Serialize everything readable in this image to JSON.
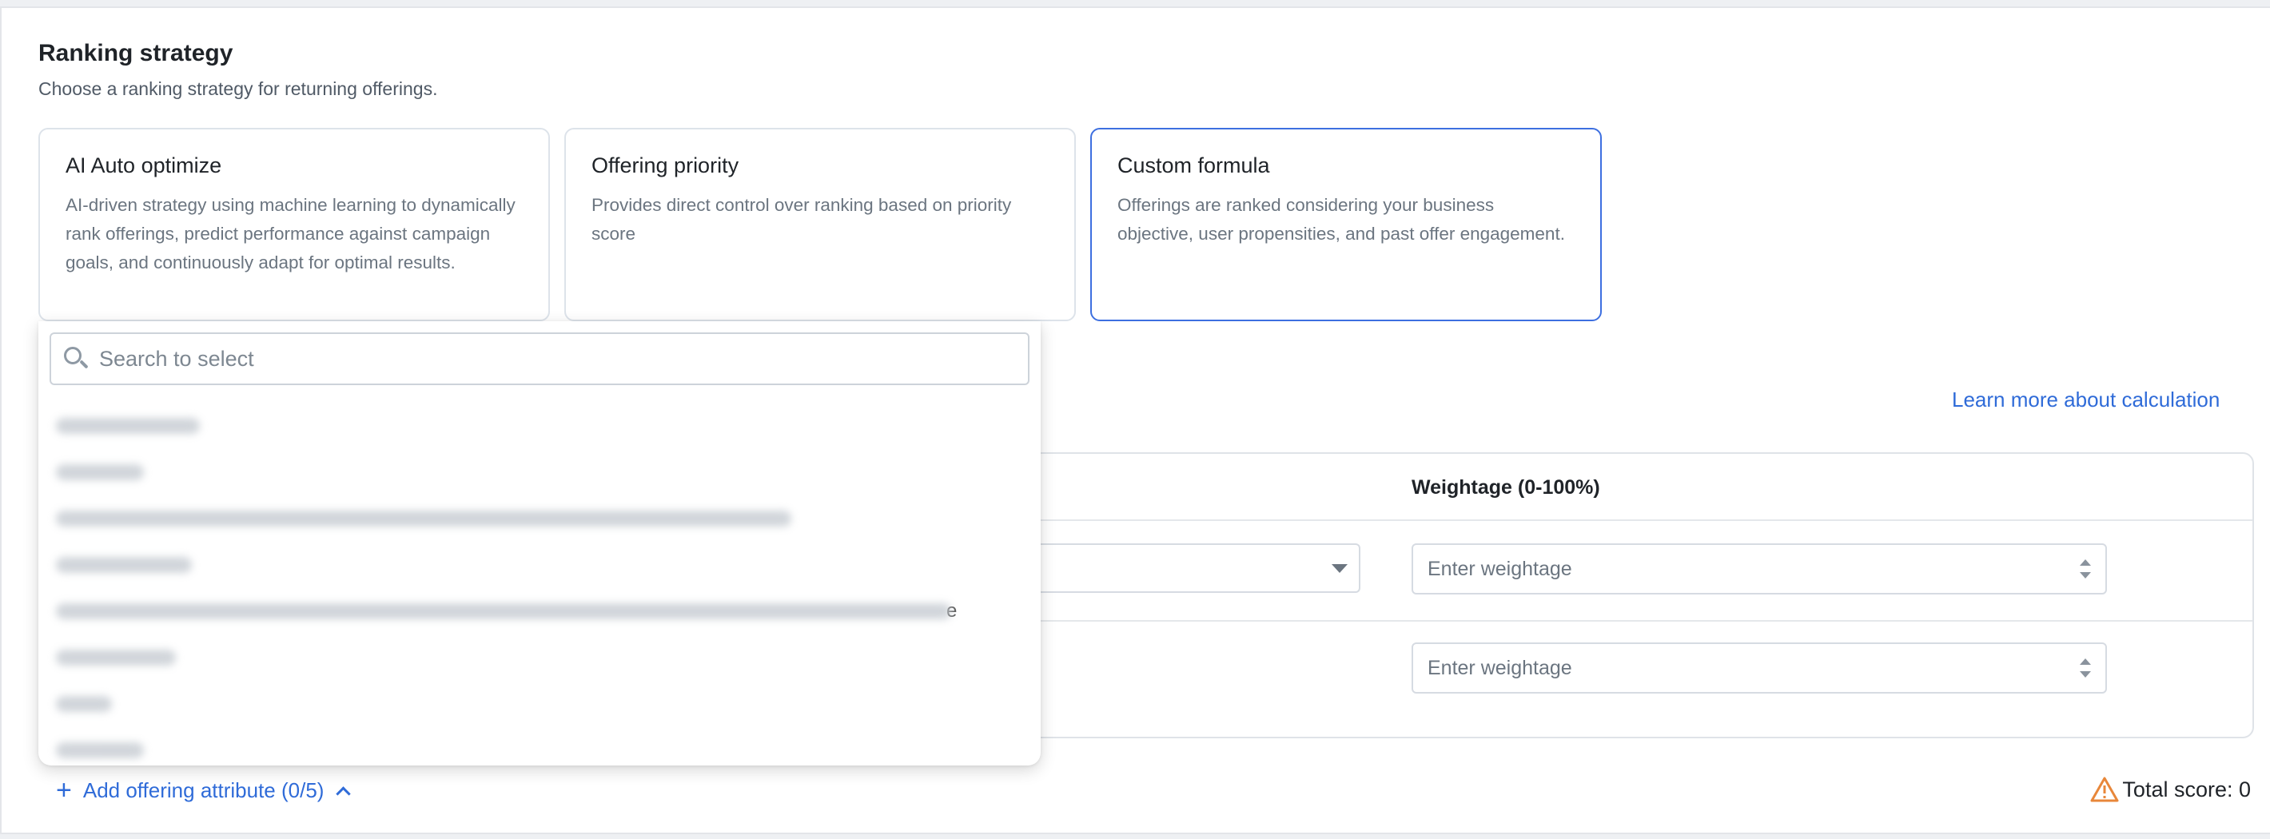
{
  "section": {
    "title": "Ranking strategy",
    "subtitle": "Choose a ranking strategy for returning offerings."
  },
  "strategies": [
    {
      "title": "AI Auto optimize",
      "description": "AI-driven strategy using machine learning to dynamically rank offerings, predict performance against campaign goals, and continuously adapt for optimal results.",
      "selected": false
    },
    {
      "title": "Offering priority",
      "description": "Provides direct control over ranking based on priority score",
      "selected": false
    },
    {
      "title": "Custom formula",
      "description": "Offerings are ranked considering your business objective, user propensities, and past offer engagement.",
      "selected": true
    }
  ],
  "learn_more": "Learn more about calculation",
  "table": {
    "weightage_header": "Weightage (0-100%)",
    "rows": [
      {
        "weightage_placeholder": "Enter weightage"
      },
      {
        "weightage_placeholder": "Enter weightage"
      }
    ]
  },
  "dropdown": {
    "search_placeholder": "Search to select",
    "search_value": "",
    "visible_option_tail": "e"
  },
  "footer": {
    "add_attribute": "Add offering attribute (0/5)",
    "total_score": "Total score: 0"
  },
  "colors": {
    "accent": "#2f6bd8",
    "selected_border": "#3d6fe0",
    "warning": "#e8873a"
  }
}
